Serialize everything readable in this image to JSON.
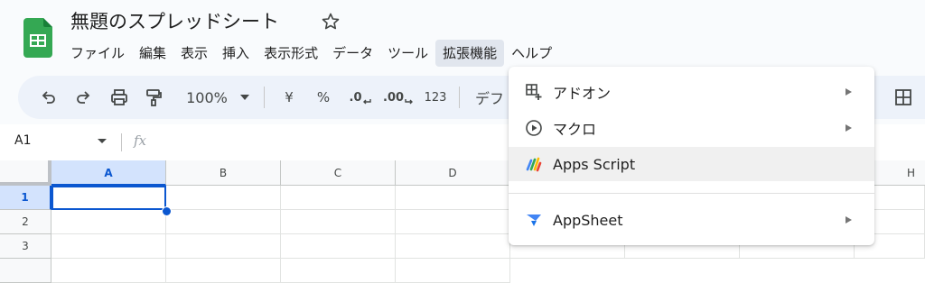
{
  "document": {
    "title": "無題のスプレッドシート"
  },
  "menubar": {
    "items": [
      {
        "label": "ファイル"
      },
      {
        "label": "編集"
      },
      {
        "label": "表示"
      },
      {
        "label": "挿入"
      },
      {
        "label": "表示形式"
      },
      {
        "label": "データ"
      },
      {
        "label": "ツール"
      },
      {
        "label": "拡張機能",
        "active": true
      },
      {
        "label": "ヘルプ"
      }
    ]
  },
  "toolbar": {
    "zoom": "100%",
    "currency": "¥",
    "percent": "%",
    "decrease_decimal": ".0",
    "increase_decimal": ".00",
    "number_format": "123",
    "font_truncated": "デフ"
  },
  "formula_bar": {
    "cell_ref": "A1",
    "fx_label": "fx"
  },
  "grid": {
    "columns": [
      "A",
      "B",
      "C",
      "D",
      "H"
    ],
    "rows": [
      "1",
      "2",
      "3"
    ],
    "selected_column": "A",
    "selected_row": "1"
  },
  "extensions_menu": {
    "items": [
      {
        "label": "アドオン",
        "icon": "addon-icon",
        "submenu": true
      },
      {
        "label": "マクロ",
        "icon": "macro-icon",
        "submenu": true
      },
      {
        "label": "Apps Script",
        "icon": "apps-script-icon",
        "submenu": false,
        "hover": true
      },
      {
        "label": "AppSheet",
        "icon": "appsheet-icon",
        "submenu": true
      }
    ]
  },
  "colors": {
    "accent": "#0b57d0",
    "sheets_green": "#34a853",
    "header_bg": "#f9fbfd",
    "toolbar_bg": "#edf2fa"
  }
}
